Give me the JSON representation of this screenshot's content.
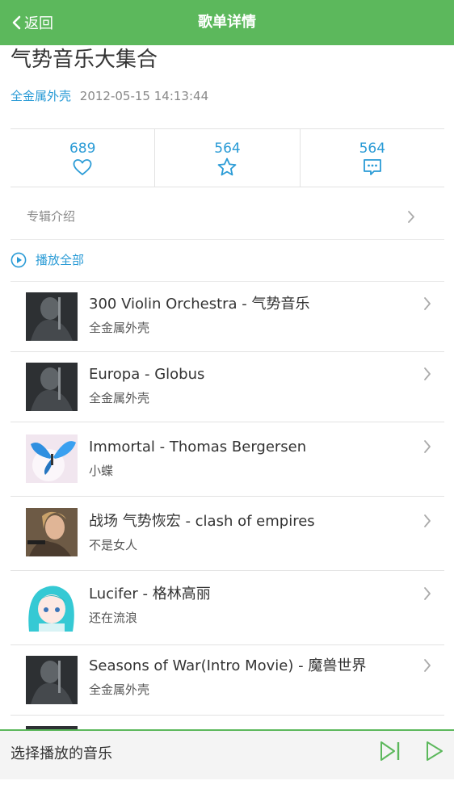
{
  "header": {
    "back_label": "返回",
    "title": "歌单详情"
  },
  "playlist": {
    "title": "气势音乐大集合",
    "author": "全金属外壳",
    "date": "2012-05-15 14:13:44"
  },
  "stats": [
    {
      "count": "689",
      "icon": "heart-icon"
    },
    {
      "count": "564",
      "icon": "star-icon"
    },
    {
      "count": "564",
      "icon": "comment-icon"
    }
  ],
  "album_intro_label": "专辑介绍",
  "play_all_label": "播放全部",
  "songs": [
    {
      "name": "300 Violin Orchestra - 气势音乐",
      "artist": "全金属外壳",
      "thumb": "dark-figure"
    },
    {
      "name": "Europa - Globus",
      "artist": "全金属外壳",
      "thumb": "dark-figure"
    },
    {
      "name": "Immortal - Thomas Bergersen",
      "artist": "小蝶",
      "thumb": "butterfly"
    },
    {
      "name": "战场 气势恢宏 - clash of empires",
      "artist": "不是女人",
      "thumb": "woman-portrait"
    },
    {
      "name": "Lucifer - 格林高丽",
      "artist": "还在流浪",
      "thumb": "anime-girl"
    },
    {
      "name": "Seasons of War(Intro Movie) - 魔兽世界",
      "artist": "全金属外壳",
      "thumb": "dark-figure"
    },
    {
      "name": "",
      "artist": "",
      "thumb": "dark-figure"
    }
  ],
  "player": {
    "status_label": "选择播放的音乐"
  },
  "colors": {
    "accent_green": "#5cb85c",
    "link_blue": "#2a9bd6"
  }
}
